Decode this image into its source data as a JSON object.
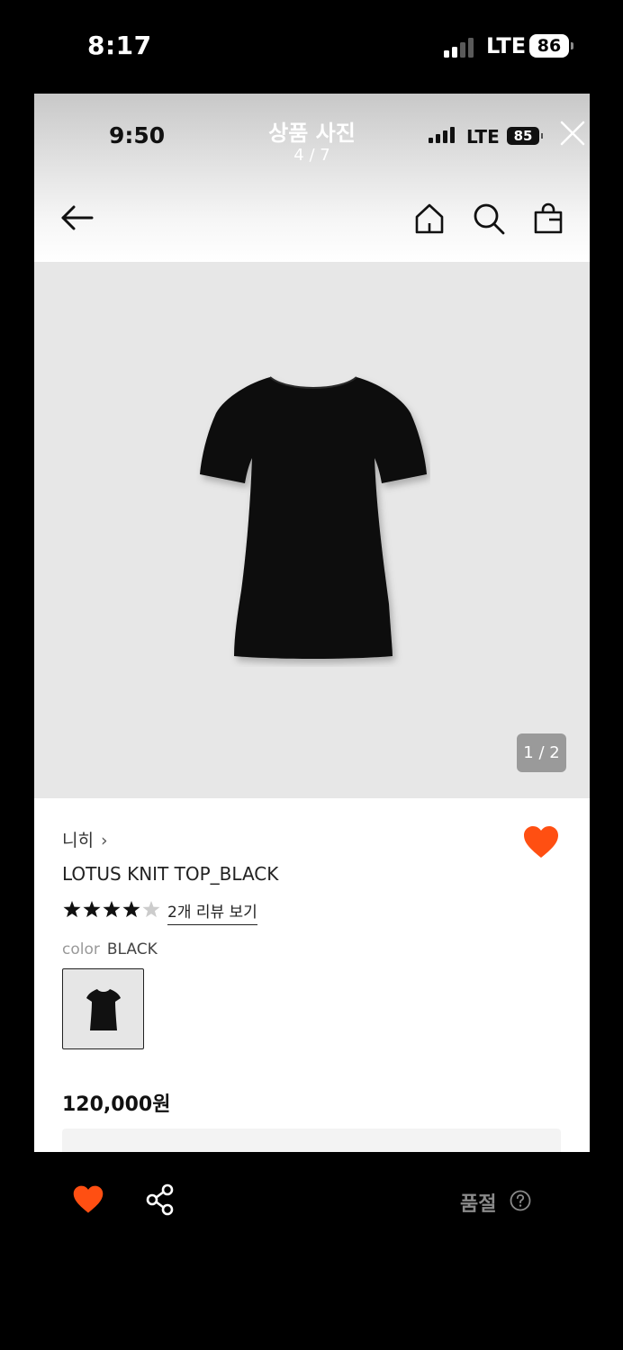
{
  "outer_status": {
    "time": "8:17",
    "network": "LTE",
    "battery": "86"
  },
  "viewer": {
    "title": "상품 사진",
    "counter": "4 / 7",
    "inner_status": {
      "time": "9:50",
      "network": "LTE",
      "battery": "85"
    }
  },
  "gallery": {
    "page_indicator": "1 / 2"
  },
  "product": {
    "brand": "니히",
    "brand_chevron": "›",
    "name": "LOTUS KNIT TOP_BLACK",
    "rating_stars": 4,
    "rating_max": 5,
    "review_link": "2개 리뷰 보기",
    "color_label": "color",
    "color_value": "BLACK",
    "price": "120,000원"
  },
  "bottom_bar": {
    "status": "품절"
  },
  "colors": {
    "accent": "#ff4f12",
    "photo_bg": "#e7e7e7",
    "star_on": "#111111",
    "star_off": "#cccccc"
  }
}
